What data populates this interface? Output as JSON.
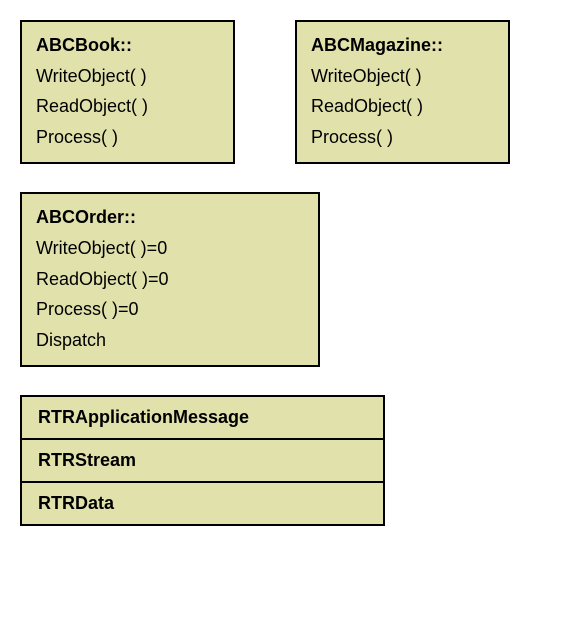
{
  "classes": {
    "book": {
      "title": "ABCBook::",
      "methods": [
        "WriteObject( )",
        "ReadObject( )",
        "Process( )"
      ]
    },
    "magazine": {
      "title": "ABCMagazine::",
      "methods": [
        "WriteObject( )",
        "ReadObject( )",
        "Process( )"
      ]
    },
    "order": {
      "title": "ABCOrder::",
      "methods": [
        "WriteObject( )=0",
        "ReadObject( )=0",
        "Process( )=0",
        "Dispatch"
      ]
    }
  },
  "stack": {
    "row0": "RTRApplicationMessage",
    "row1": "RTRStream",
    "row2": "RTRData"
  }
}
